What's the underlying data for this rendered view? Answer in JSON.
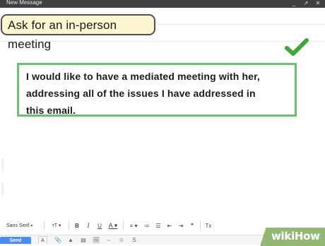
{
  "window": {
    "title": "New Message",
    "controls": [
      "_",
      "↗",
      "✕"
    ]
  },
  "banner": {
    "text": "Ask for an in-person meeting"
  },
  "callout": {
    "line1": "I would like to have a mediated meeting with her,",
    "line2": "addressing all of the issues I have addressed in",
    "line3": "this email."
  },
  "toolbar": {
    "font_label": "Sans Serif",
    "font_arrow": "▾",
    "size_label": "ᴛT ▾",
    "bold": "B",
    "italic": "I",
    "underline": "U",
    "text_color": "A ▾",
    "align": "≡ ▾",
    "numbered_list": "≔",
    "bulleted_list": "☰",
    "indent_less": "⇤",
    "indent_more": "⇥",
    "quote": "❞",
    "clear_format": "Tx"
  },
  "bottom": {
    "send_label": "Send",
    "format_label": "A",
    "icons": [
      "📎",
      "▲",
      "▤",
      "🖼",
      "⇔",
      "☺",
      "S"
    ]
  },
  "watermark": {
    "wiki": "wiki",
    "how": "How"
  },
  "colors": {
    "accent_green": "#6cc26c",
    "check_green": "#3ea83e",
    "banner_bg": "#fbf5d0",
    "send_blue": "#4b8df8",
    "wikihow_green": "#93b874"
  },
  "icons": {
    "check": "check-icon"
  }
}
